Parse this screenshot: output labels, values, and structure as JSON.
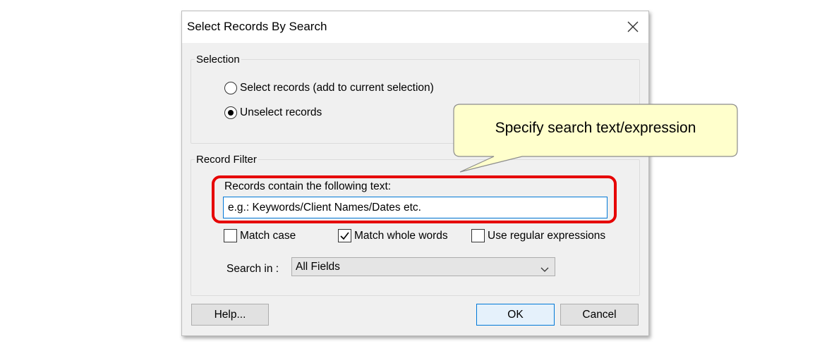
{
  "dialog": {
    "title": "Select Records By Search",
    "close_icon": "close-icon"
  },
  "selection": {
    "label": "Selection",
    "options": [
      {
        "label": "Select records (add to current selection)",
        "checked": false
      },
      {
        "label": "Unselect records",
        "checked": true
      }
    ]
  },
  "record_filter": {
    "label": "Record Filter",
    "text_label": "Records contain the following text:",
    "text_placeholder": "e.g.: Keywords/Client Names/Dates etc.",
    "text_value": "",
    "checkboxes": [
      {
        "label": "Match case",
        "checked": false
      },
      {
        "label": "Match whole words",
        "checked": true
      },
      {
        "label": "Use regular expressions",
        "checked": false
      }
    ],
    "search_in_label": "Search in :",
    "search_in_value": "All Fields"
  },
  "buttons": {
    "help": "Help...",
    "ok": "OK",
    "cancel": "Cancel"
  },
  "callout": {
    "text": "Specify search text/expression"
  },
  "colors": {
    "highlight": "#e60000",
    "callout_fill": "#ffffcc",
    "accent": "#0078d7"
  }
}
